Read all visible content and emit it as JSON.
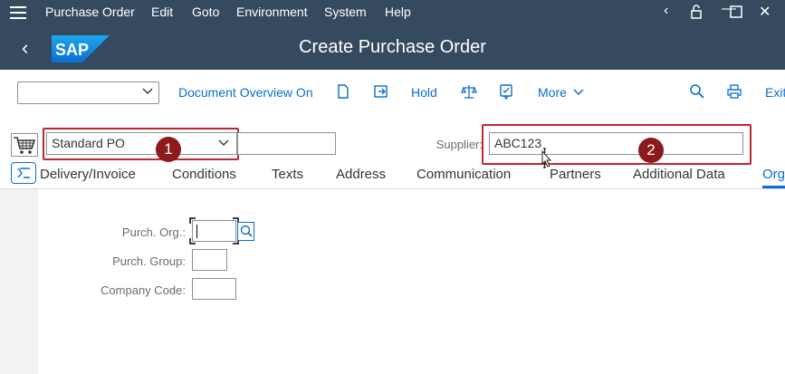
{
  "menu": {
    "items": [
      "Purchase Order",
      "Edit",
      "Goto",
      "Environment",
      "System",
      "Help"
    ]
  },
  "window_controls": {
    "back": "‹",
    "minimize": "—",
    "maximize": "☐",
    "close": "✕"
  },
  "header": {
    "back_icon": "‹",
    "logo_text": "SAP",
    "title": "Create Purchase Order"
  },
  "toolbar": {
    "doc_overview": "Document Overview On",
    "hold": "Hold",
    "more": "More",
    "exit": "Exit"
  },
  "form": {
    "po_type": "Standard PO",
    "po_number": "",
    "supplier_label": "Supplier:",
    "supplier_value": "ABC123",
    "badge1": "1",
    "badge2": "2"
  },
  "tabs": [
    "Delivery/Invoice",
    "Conditions",
    "Texts",
    "Address",
    "Communication",
    "Partners",
    "Additional Data",
    "Org"
  ],
  "org": {
    "purch_org_label": "Purch. Org.:",
    "purch_org_value": "",
    "purch_group_label": "Purch. Group:",
    "purch_group_value": "",
    "company_code_label": "Company Code:",
    "company_code_value": ""
  },
  "colors": {
    "shell": "#354a5f",
    "accent": "#0a6ed1",
    "highlight": "#c0282e",
    "badge": "#8b1a1a"
  }
}
